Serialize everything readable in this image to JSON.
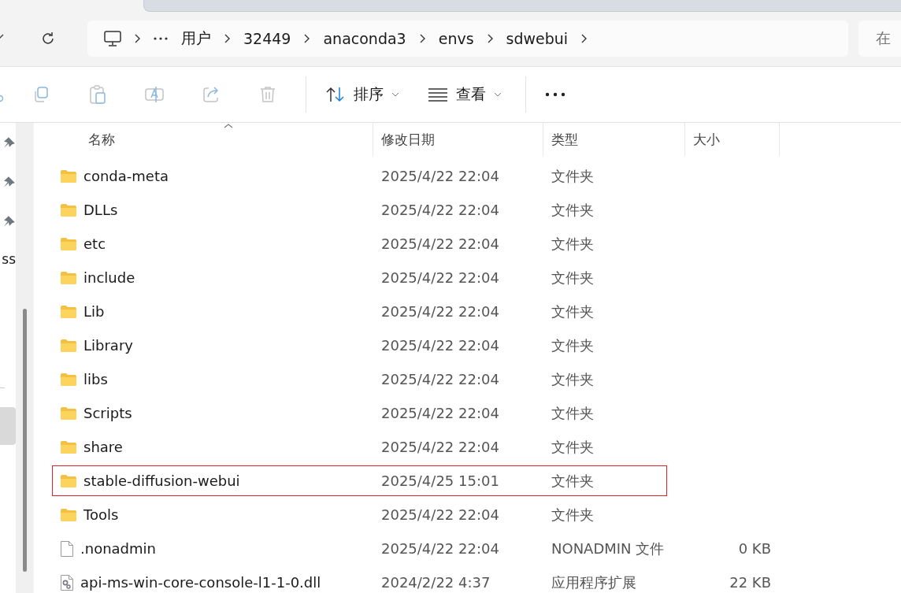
{
  "breadcrumb": {
    "items": [
      "用户",
      "32449",
      "anaconda3",
      "envs",
      "sdwebui"
    ]
  },
  "search": {
    "placeholder": "在"
  },
  "toolbar": {
    "sort_label": "排序",
    "view_label": "查看"
  },
  "nav": {
    "items": [
      {
        "kind": "pinned"
      },
      {
        "kind": "pinned"
      },
      {
        "kind": "pinned"
      },
      {
        "kind": "text",
        "label": "ss"
      }
    ]
  },
  "table": {
    "columns": [
      "名称",
      "修改日期",
      "类型",
      "大小"
    ],
    "rows": [
      {
        "kind": "folder",
        "name": "conda-meta",
        "date": "2025/4/22 22:04",
        "type": "文件夹",
        "highlighted": false
      },
      {
        "kind": "folder",
        "name": "DLLs",
        "date": "2025/4/22 22:04",
        "type": "文件夹",
        "highlighted": false
      },
      {
        "kind": "folder",
        "name": "etc",
        "date": "2025/4/22 22:04",
        "type": "文件夹",
        "highlighted": false
      },
      {
        "kind": "folder",
        "name": "include",
        "date": "2025/4/22 22:04",
        "type": "文件夹",
        "highlighted": false
      },
      {
        "kind": "folder",
        "name": "Lib",
        "date": "2025/4/22 22:04",
        "type": "文件夹",
        "highlighted": false
      },
      {
        "kind": "folder",
        "name": "Library",
        "date": "2025/4/22 22:04",
        "type": "文件夹",
        "highlighted": false
      },
      {
        "kind": "folder",
        "name": "libs",
        "date": "2025/4/22 22:04",
        "type": "文件夹",
        "highlighted": false
      },
      {
        "kind": "folder",
        "name": "Scripts",
        "date": "2025/4/22 22:04",
        "type": "文件夹",
        "highlighted": false
      },
      {
        "kind": "folder",
        "name": "share",
        "date": "2025/4/22 22:04",
        "type": "文件夹",
        "highlighted": false
      },
      {
        "kind": "folder",
        "name": "stable-diffusion-webui",
        "date": "2025/4/25 15:01",
        "type": "文件夹",
        "highlighted": true
      },
      {
        "kind": "folder",
        "name": "Tools",
        "date": "2025/4/22 22:04",
        "type": "文件夹",
        "highlighted": false
      },
      {
        "kind": "file",
        "name": ".nonadmin",
        "date": "2025/4/22 22:04",
        "type": "NONADMIN 文件",
        "size": "0 KB",
        "highlighted": false
      },
      {
        "kind": "dll",
        "name": "api-ms-win-core-console-l1-1-0.dll",
        "date": "2024/2/22 4:37",
        "type": "应用程序扩展",
        "size": "22 KB",
        "highlighted": false
      }
    ]
  }
}
